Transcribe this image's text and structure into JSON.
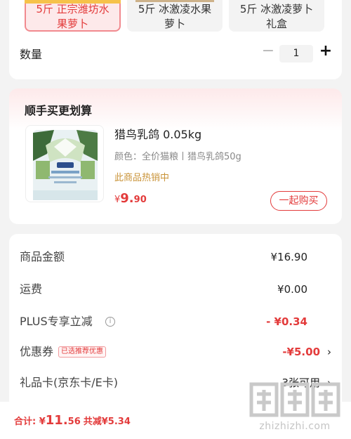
{
  "variants": {
    "options": [
      {
        "line1": "5斤 正宗潍坊水",
        "line2": "果萝卜",
        "selected": true
      },
      {
        "line1": "5斤 冰激凌水果",
        "line2": "萝卜",
        "selected": false
      },
      {
        "line1": "5斤 冰激凌萝卜",
        "line2": "礼盒",
        "selected": false
      }
    ]
  },
  "quantity": {
    "label": "数量",
    "minus": "−",
    "value": "1",
    "plus": "+"
  },
  "bundle": {
    "title": "顺手买更划算",
    "product": {
      "name": "猎鸟乳鸽 0.05kg",
      "attr": "颜色：全价猫粮丨猎鸟乳鸽50g",
      "hot": "此商品热销中",
      "price_symbol": "¥",
      "price_int": "9.",
      "price_dec": "90"
    },
    "buy_label": "一起购买"
  },
  "summary": {
    "rows": [
      {
        "label": "商品金额",
        "value": "¥16.90"
      },
      {
        "label": "运费",
        "value": "¥0.00"
      },
      {
        "label": "PLUS专享立减",
        "value": "- ¥0.34"
      },
      {
        "label": "优惠券",
        "badge": "已选推荐优惠",
        "value": "-¥5.00"
      },
      {
        "label": "礼品卡(京东卡/E卡)",
        "value": "3张可用"
      }
    ],
    "info_glyph": "i",
    "chevron": "›"
  },
  "bottom": {
    "label": "合计:",
    "symbol": " ¥",
    "int": "11.",
    "dec": "56",
    "save": "共减¥5.34"
  },
  "watermark": {
    "text": "zhizhizhi.com"
  },
  "colors": {
    "accent": "#e33b3b",
    "hot": "#c99338"
  }
}
